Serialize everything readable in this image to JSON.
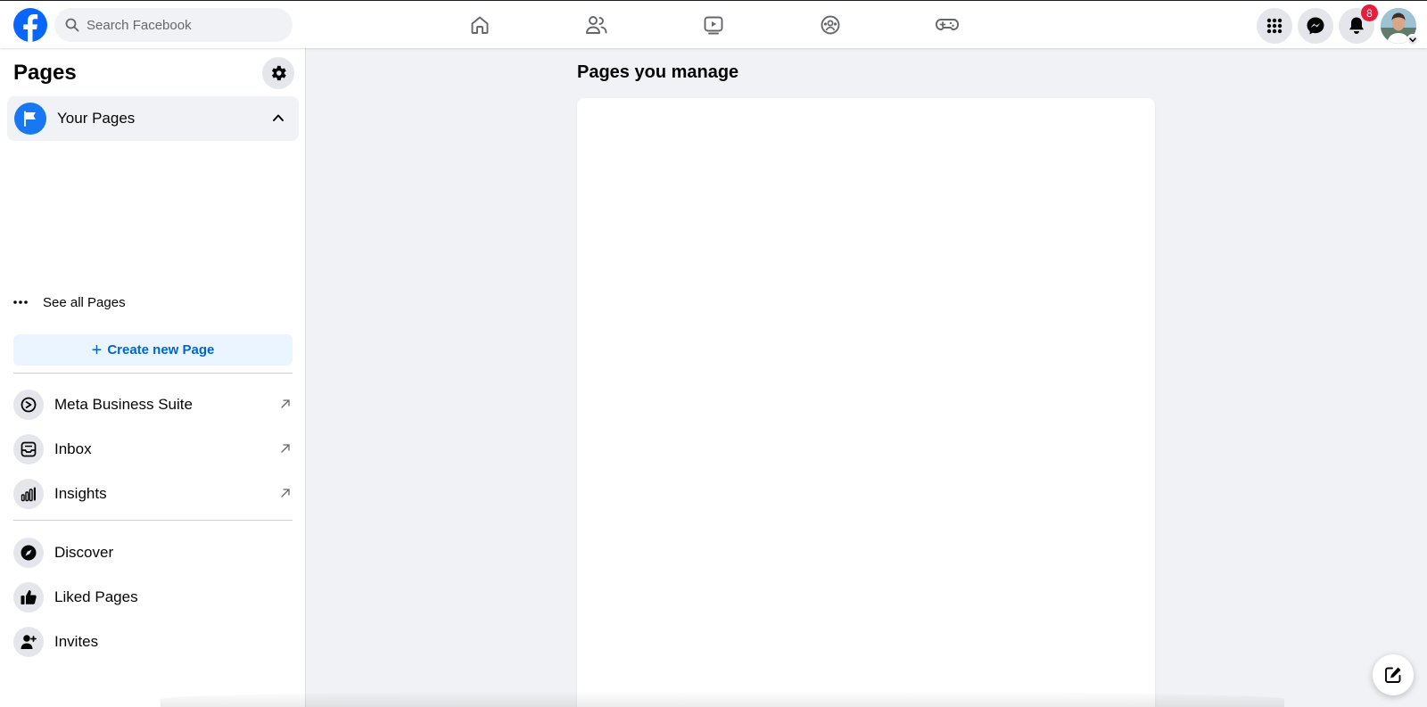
{
  "header": {
    "logo_icon": "facebook-logo",
    "search": {
      "placeholder": "Search Facebook",
      "icon": "search-icon"
    },
    "nav_tabs": [
      {
        "name": "Home",
        "icon": "home-icon"
      },
      {
        "name": "Friends",
        "icon": "friends-icon"
      },
      {
        "name": "Watch",
        "icon": "video-icon"
      },
      {
        "name": "Groups",
        "icon": "groups-icon"
      },
      {
        "name": "Gaming",
        "icon": "gaming-icon"
      }
    ],
    "actions": [
      {
        "name": "Menu",
        "icon": "grid-menu-icon"
      },
      {
        "name": "Messenger",
        "icon": "messenger-icon"
      },
      {
        "name": "Notifications",
        "icon": "bell-icon",
        "badge": "8"
      },
      {
        "name": "Account",
        "icon": "avatar"
      }
    ],
    "brand_color": "#0866ff",
    "badge_color": "#e41e3f"
  },
  "sidebar": {
    "title": "Pages",
    "settings_icon": "gear-icon",
    "your_pages": {
      "label": "Your Pages",
      "icon": "flag-icon",
      "expanded": true
    },
    "see_all": {
      "label": "See all Pages",
      "icon": "more-dots-icon"
    },
    "create_button": {
      "label": "Create new Page",
      "icon": "plus-icon"
    },
    "tools": [
      {
        "label": "Meta Business Suite",
        "icon": "business-suite-icon",
        "external": true
      },
      {
        "label": "Inbox",
        "icon": "inbox-icon",
        "external": true
      },
      {
        "label": "Insights",
        "icon": "insights-icon",
        "external": true
      }
    ],
    "links": [
      {
        "label": "Discover",
        "icon": "compass-icon"
      },
      {
        "label": "Liked Pages",
        "icon": "thumbs-up-icon"
      },
      {
        "label": "Invites",
        "icon": "add-person-icon"
      }
    ]
  },
  "main": {
    "title": "Pages you manage"
  },
  "compose_icon": "compose-icon"
}
